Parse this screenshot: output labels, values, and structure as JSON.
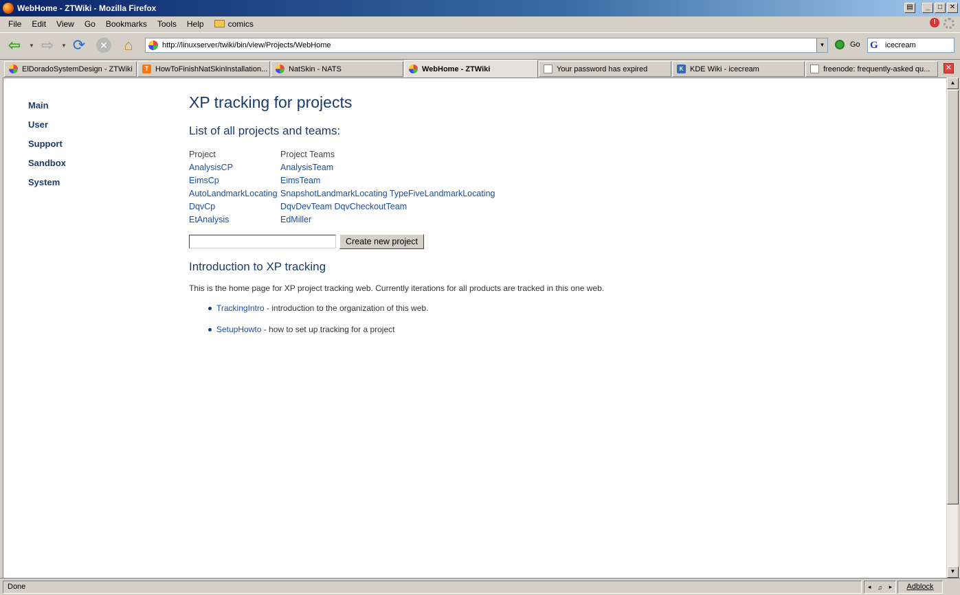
{
  "window": {
    "title": "WebHome - ZTWiki - Mozilla Firefox"
  },
  "menu": {
    "items": [
      "File",
      "Edit",
      "View",
      "Go",
      "Bookmarks",
      "Tools",
      "Help"
    ],
    "bookmark_folder": "comics"
  },
  "navbar": {
    "url": "http://linuxserver/twiki/bin/view/Projects/WebHome",
    "go_label": "Go",
    "search_value": "icecream"
  },
  "tabs": [
    {
      "label": "ElDoradoSystemDesign  - ZTWiki",
      "icon": "twiki-icon"
    },
    {
      "label": "HowToFinishNatSkinInstallation...",
      "icon": "t-icon"
    },
    {
      "label": "NatSkin - NATS",
      "icon": "twiki-icon"
    },
    {
      "label": "WebHome  - ZTWiki",
      "icon": "twiki-icon",
      "active": true
    },
    {
      "label": "Your password has expired",
      "icon": "document-icon"
    },
    {
      "label": "KDE Wiki - icecream",
      "icon": "kde-icon"
    },
    {
      "label": "freenode: frequently-asked qu...",
      "icon": "document-icon"
    }
  ],
  "sidebar": {
    "items": [
      "Main",
      "User",
      "Support",
      "Sandbox",
      "System"
    ]
  },
  "page": {
    "title": "XP tracking for projects",
    "projects_heading": "List of all projects and teams:",
    "table_headers": [
      "Project",
      "Project Teams"
    ],
    "rows": [
      {
        "project": "AnalysisCP",
        "teams": "AnalysisTeam"
      },
      {
        "project": "EimsCp",
        "teams": "EimsTeam"
      },
      {
        "project": "AutoLandmarkLocating",
        "teams": "SnapshotLandmarkLocating TypeFiveLandmarkLocating"
      },
      {
        "project": "DqvCp",
        "teams": "DqvDevTeam DqvCheckoutTeam"
      },
      {
        "project": "EtAnalysis",
        "teams": "EdMiller"
      }
    ],
    "new_project_value": "",
    "create_button": "Create new project",
    "intro_heading": "Introduction to XP tracking",
    "intro_text": "This is the home page for XP project tracking web. Currently iterations for all products are tracked in this one web.",
    "links": [
      {
        "link": "TrackingIntro",
        "desc": " - introduction to the organization of this web."
      },
      {
        "link": "SetupHowto",
        "desc": " - how to set up tracking for a project"
      }
    ]
  },
  "status": {
    "text": "Done",
    "adblock": "Adblock"
  }
}
